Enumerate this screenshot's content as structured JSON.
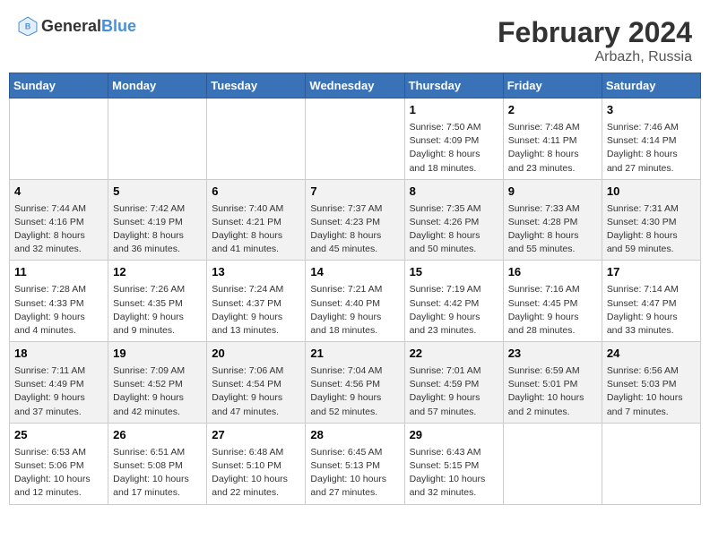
{
  "header": {
    "logo_general": "General",
    "logo_blue": "Blue",
    "month_year": "February 2024",
    "location": "Arbazh, Russia"
  },
  "weekdays": [
    "Sunday",
    "Monday",
    "Tuesday",
    "Wednesday",
    "Thursday",
    "Friday",
    "Saturday"
  ],
  "weeks": [
    [
      {
        "num": "",
        "detail": ""
      },
      {
        "num": "",
        "detail": ""
      },
      {
        "num": "",
        "detail": ""
      },
      {
        "num": "",
        "detail": ""
      },
      {
        "num": "1",
        "detail": "Sunrise: 7:50 AM\nSunset: 4:09 PM\nDaylight: 8 hours\nand 18 minutes."
      },
      {
        "num": "2",
        "detail": "Sunrise: 7:48 AM\nSunset: 4:11 PM\nDaylight: 8 hours\nand 23 minutes."
      },
      {
        "num": "3",
        "detail": "Sunrise: 7:46 AM\nSunset: 4:14 PM\nDaylight: 8 hours\nand 27 minutes."
      }
    ],
    [
      {
        "num": "4",
        "detail": "Sunrise: 7:44 AM\nSunset: 4:16 PM\nDaylight: 8 hours\nand 32 minutes."
      },
      {
        "num": "5",
        "detail": "Sunrise: 7:42 AM\nSunset: 4:19 PM\nDaylight: 8 hours\nand 36 minutes."
      },
      {
        "num": "6",
        "detail": "Sunrise: 7:40 AM\nSunset: 4:21 PM\nDaylight: 8 hours\nand 41 minutes."
      },
      {
        "num": "7",
        "detail": "Sunrise: 7:37 AM\nSunset: 4:23 PM\nDaylight: 8 hours\nand 45 minutes."
      },
      {
        "num": "8",
        "detail": "Sunrise: 7:35 AM\nSunset: 4:26 PM\nDaylight: 8 hours\nand 50 minutes."
      },
      {
        "num": "9",
        "detail": "Sunrise: 7:33 AM\nSunset: 4:28 PM\nDaylight: 8 hours\nand 55 minutes."
      },
      {
        "num": "10",
        "detail": "Sunrise: 7:31 AM\nSunset: 4:30 PM\nDaylight: 8 hours\nand 59 minutes."
      }
    ],
    [
      {
        "num": "11",
        "detail": "Sunrise: 7:28 AM\nSunset: 4:33 PM\nDaylight: 9 hours\nand 4 minutes."
      },
      {
        "num": "12",
        "detail": "Sunrise: 7:26 AM\nSunset: 4:35 PM\nDaylight: 9 hours\nand 9 minutes."
      },
      {
        "num": "13",
        "detail": "Sunrise: 7:24 AM\nSunset: 4:37 PM\nDaylight: 9 hours\nand 13 minutes."
      },
      {
        "num": "14",
        "detail": "Sunrise: 7:21 AM\nSunset: 4:40 PM\nDaylight: 9 hours\nand 18 minutes."
      },
      {
        "num": "15",
        "detail": "Sunrise: 7:19 AM\nSunset: 4:42 PM\nDaylight: 9 hours\nand 23 minutes."
      },
      {
        "num": "16",
        "detail": "Sunrise: 7:16 AM\nSunset: 4:45 PM\nDaylight: 9 hours\nand 28 minutes."
      },
      {
        "num": "17",
        "detail": "Sunrise: 7:14 AM\nSunset: 4:47 PM\nDaylight: 9 hours\nand 33 minutes."
      }
    ],
    [
      {
        "num": "18",
        "detail": "Sunrise: 7:11 AM\nSunset: 4:49 PM\nDaylight: 9 hours\nand 37 minutes."
      },
      {
        "num": "19",
        "detail": "Sunrise: 7:09 AM\nSunset: 4:52 PM\nDaylight: 9 hours\nand 42 minutes."
      },
      {
        "num": "20",
        "detail": "Sunrise: 7:06 AM\nSunset: 4:54 PM\nDaylight: 9 hours\nand 47 minutes."
      },
      {
        "num": "21",
        "detail": "Sunrise: 7:04 AM\nSunset: 4:56 PM\nDaylight: 9 hours\nand 52 minutes."
      },
      {
        "num": "22",
        "detail": "Sunrise: 7:01 AM\nSunset: 4:59 PM\nDaylight: 9 hours\nand 57 minutes."
      },
      {
        "num": "23",
        "detail": "Sunrise: 6:59 AM\nSunset: 5:01 PM\nDaylight: 10 hours\nand 2 minutes."
      },
      {
        "num": "24",
        "detail": "Sunrise: 6:56 AM\nSunset: 5:03 PM\nDaylight: 10 hours\nand 7 minutes."
      }
    ],
    [
      {
        "num": "25",
        "detail": "Sunrise: 6:53 AM\nSunset: 5:06 PM\nDaylight: 10 hours\nand 12 minutes."
      },
      {
        "num": "26",
        "detail": "Sunrise: 6:51 AM\nSunset: 5:08 PM\nDaylight: 10 hours\nand 17 minutes."
      },
      {
        "num": "27",
        "detail": "Sunrise: 6:48 AM\nSunset: 5:10 PM\nDaylight: 10 hours\nand 22 minutes."
      },
      {
        "num": "28",
        "detail": "Sunrise: 6:45 AM\nSunset: 5:13 PM\nDaylight: 10 hours\nand 27 minutes."
      },
      {
        "num": "29",
        "detail": "Sunrise: 6:43 AM\nSunset: 5:15 PM\nDaylight: 10 hours\nand 32 minutes."
      },
      {
        "num": "",
        "detail": ""
      },
      {
        "num": "",
        "detail": ""
      }
    ]
  ]
}
